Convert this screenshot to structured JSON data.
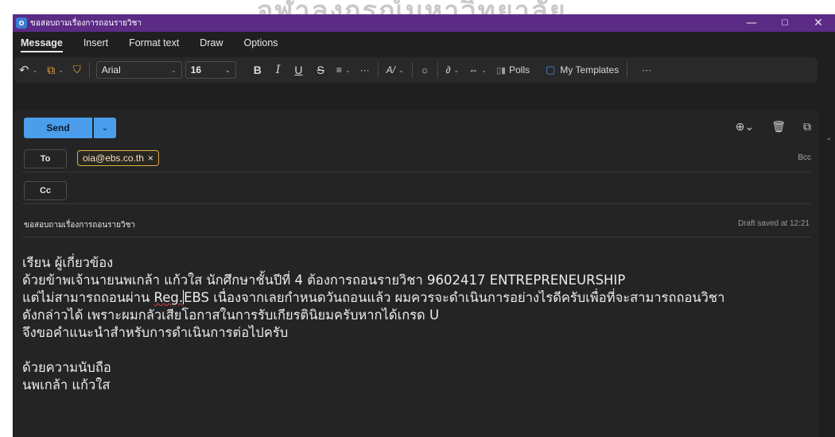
{
  "watermark": "จุฬาลงกรณ์มหาวิทยาลัย",
  "window": {
    "title": "ขอสอบถามเรื่องการถอนรายวิชา",
    "app_icon": "outlook-icon",
    "controls": {
      "minimize": "—",
      "maximize": "☐",
      "close": "✕"
    }
  },
  "menu": {
    "tabs": [
      "Message",
      "Insert",
      "Format text",
      "Draw",
      "Options"
    ],
    "active": "Message"
  },
  "ribbon": {
    "undo": "↶",
    "clipboard": "⧉",
    "format_painter": "🖌",
    "font_name": "Arial",
    "font_size": "16",
    "bold": "B",
    "italic": "I",
    "underline": "U",
    "strike": "S",
    "align": "≡",
    "more1": "···",
    "styles": "A/",
    "theme": "☼",
    "attach": "⎯",
    "link": "⇔",
    "polls_label": "Polls",
    "templates_label": "My Templates",
    "more2": "···",
    "accent_color": "#4a9eec"
  },
  "compose": {
    "send_label": "Send",
    "to_label": "To",
    "cc_label": "Cc",
    "bcc_label": "Bcc",
    "to_recipient": "oia@ebs.co.th",
    "subject": "ขอสอบถามเรื่องการถอนรายวิชา",
    "draft_status": "Draft saved at 12:21"
  },
  "body": {
    "line1": "เรียน ผู้เกี่ยวข้อง",
    "line2": "ด้วยข้าพเจ้านายนพเกล้า แก้วใส นักศึกษาชั้นปีที่ 4 ต้องการถอนรายวิชา 9602417 ENTREPRENEURSHIP",
    "line3_pre": "แต่ไม่สามารถถอนผ่าน ",
    "line3_reg": "Reg.",
    "line3_post": "EBS เนื่องจากเลยกำหนดวันถอนแล้ว ผมควรจะดำเนินการอย่างไรดีครับเพื่อที่จะสามารถถอนวิชา",
    "line4": "ดังกล่าวได้ เพราะผมกลัวเสียโอกาสในการรับเกียรตินิยมครับหากได้เกรด U",
    "line5": "จึงขอคำแนะนำสำหรับการดำเนินการต่อไปครับ",
    "closing": "ด้วยความนับถือ",
    "signature": "นพเกล้า แก้วใส"
  }
}
